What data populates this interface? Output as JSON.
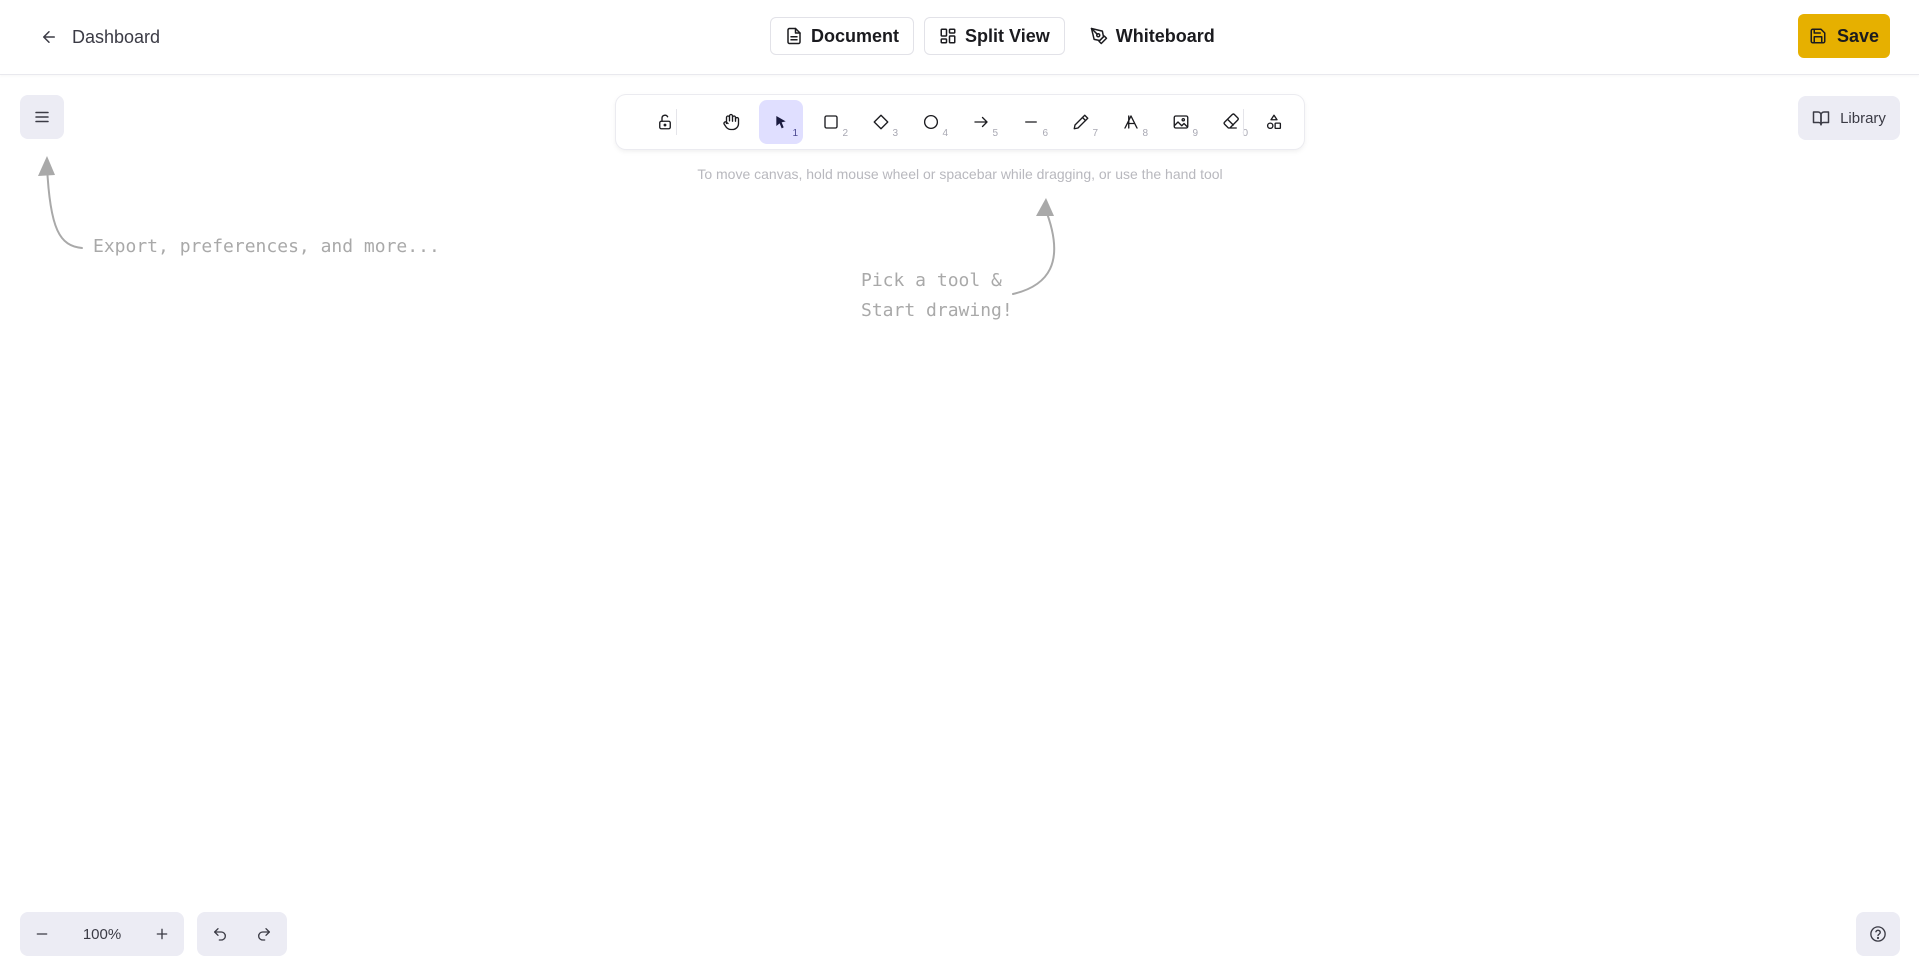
{
  "header": {
    "back_label": "Dashboard",
    "tabs": [
      {
        "label": "Document"
      },
      {
        "label": "Split View"
      },
      {
        "label": "Whiteboard"
      }
    ],
    "save_label": "Save"
  },
  "library": {
    "label": "Library"
  },
  "toolbar": {
    "active_tool": "selection",
    "tools": [
      {
        "name": "lock",
        "shortcut": ""
      },
      {
        "name": "hand",
        "shortcut": ""
      },
      {
        "name": "selection",
        "shortcut": "1"
      },
      {
        "name": "rectangle",
        "shortcut": "2"
      },
      {
        "name": "diamond",
        "shortcut": "3"
      },
      {
        "name": "ellipse",
        "shortcut": "4"
      },
      {
        "name": "arrow",
        "shortcut": "5"
      },
      {
        "name": "line",
        "shortcut": "6"
      },
      {
        "name": "pencil",
        "shortcut": "7"
      },
      {
        "name": "text",
        "shortcut": "8"
      },
      {
        "name": "image",
        "shortcut": "9"
      },
      {
        "name": "eraser",
        "shortcut": "0"
      },
      {
        "name": "extra-tools",
        "shortcut": ""
      }
    ]
  },
  "canvas": {
    "hint": "To move canvas, hold mouse wheel or spacebar while dragging, or use the hand tool",
    "menu_note": "Export, preferences, and more...",
    "tool_note": "Pick a tool &\nStart drawing!"
  },
  "footer": {
    "zoom_level": "100%"
  },
  "colors": {
    "accent_save": "#e6b000",
    "active_tool_bg": "#e0dfff",
    "island_bg": "#ececf4",
    "hint_text": "#b8b8be",
    "note_text": "#a9a9a9"
  },
  "icons": [
    "arrow-left-icon",
    "document-icon",
    "split-view-icon",
    "whiteboard-icon",
    "save-icon",
    "menu-icon",
    "library-icon",
    "unlock-icon",
    "hand-icon",
    "pointer-icon",
    "square-icon",
    "diamond-icon",
    "circle-icon",
    "arrow-right-icon",
    "line-icon",
    "pencil-icon",
    "text-icon",
    "image-icon",
    "eraser-icon",
    "shapes-icon",
    "minus-icon",
    "plus-icon",
    "undo-icon",
    "redo-icon",
    "help-icon"
  ]
}
